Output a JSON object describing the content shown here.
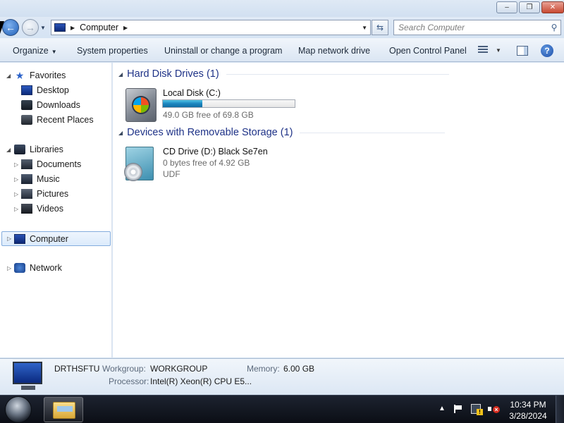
{
  "window": {
    "caption_buttons": {
      "minimize": "–",
      "maximize": "❐",
      "close": "✕"
    }
  },
  "address": {
    "crumb": "Computer",
    "search_placeholder": "Search Computer"
  },
  "toolbar": {
    "organize": "Organize",
    "system_properties": "System properties",
    "uninstall": "Uninstall or change a program",
    "map_network_drive": "Map network drive",
    "open_control_panel": "Open Control Panel",
    "help": "?"
  },
  "nav": {
    "favorites": "Favorites",
    "desktop": "Desktop",
    "downloads": "Downloads",
    "recent_places": "Recent Places",
    "libraries": "Libraries",
    "documents": "Documents",
    "music": "Music",
    "pictures": "Pictures",
    "videos": "Videos",
    "computer": "Computer",
    "network": "Network"
  },
  "content": {
    "groups": [
      {
        "title": "Hard Disk Drives (1)",
        "items": [
          {
            "name": "Local Disk (C:)",
            "free_text": "49.0 GB free of 69.8 GB",
            "used_fraction": 0.298
          }
        ]
      },
      {
        "title": "Devices with Removable Storage (1)",
        "items": [
          {
            "name": "CD Drive (D:) Black Se7en",
            "free_text": "0 bytes free of 4.92 GB",
            "filesystem": "UDF"
          }
        ]
      }
    ]
  },
  "details": {
    "computer_name": "DRTHSFTU",
    "workgroup_label": "Workgroup:",
    "workgroup_value": "WORKGROUP",
    "memory_label": "Memory:",
    "memory_value": "6.00 GB",
    "processor_label": "Processor:",
    "processor_value": "Intel(R) Xeon(R) CPU E5..."
  },
  "taskbar": {
    "time": "10:34 PM",
    "date": "3/28/2024",
    "tray_arrow": "▲"
  },
  "icons": {
    "back": "back-arrow-icon",
    "forward": "forward-arrow-icon",
    "search": "magnifier-icon",
    "refresh": "refresh-icon"
  }
}
